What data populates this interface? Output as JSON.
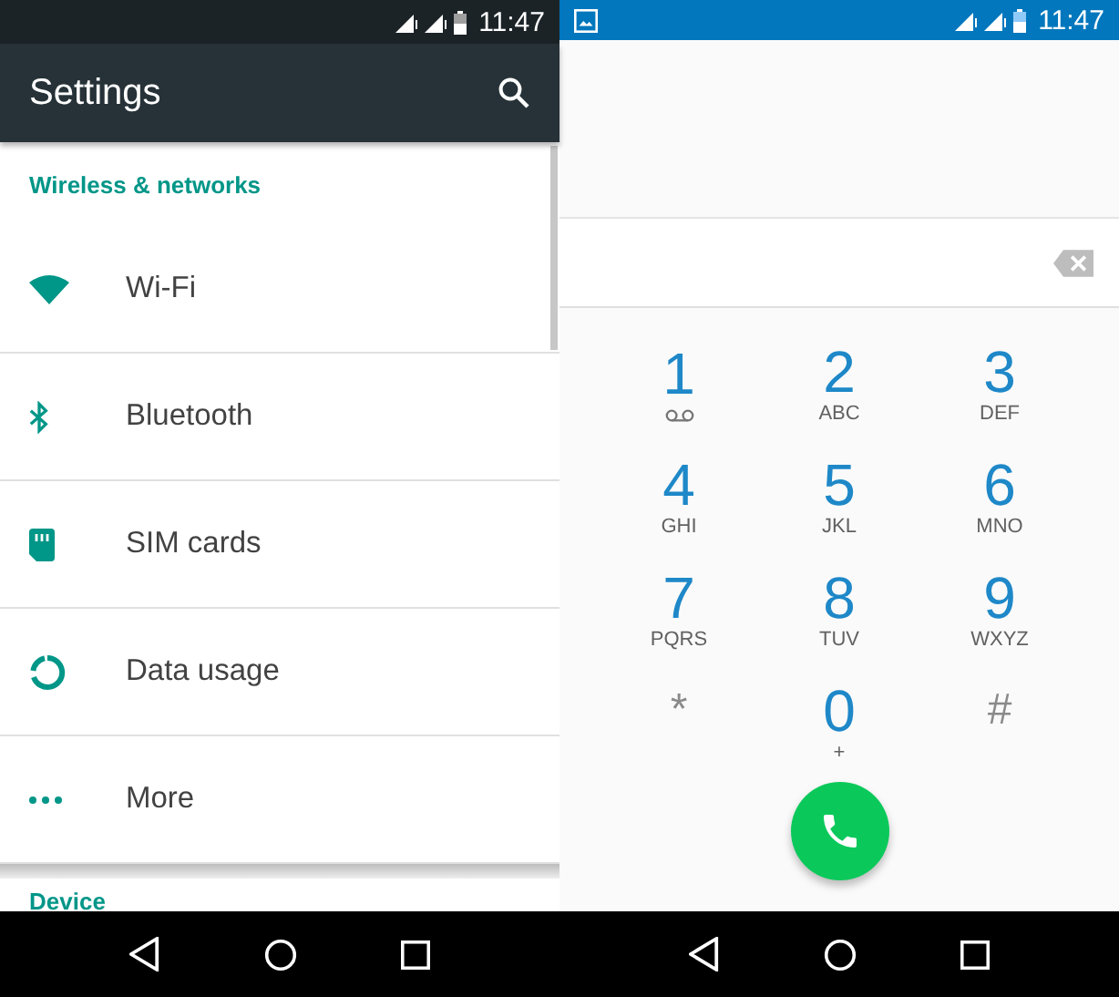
{
  "settings_screen": {
    "status_bar": {
      "time": "11:47"
    },
    "toolbar": {
      "title": "Settings"
    },
    "sections": [
      {
        "header": "Wireless & networks",
        "items": [
          {
            "label": "Wi-Fi"
          },
          {
            "label": "Bluetooth"
          },
          {
            "label": "SIM cards"
          },
          {
            "label": "Data usage"
          },
          {
            "label": "More"
          }
        ]
      },
      {
        "header": "Device"
      }
    ]
  },
  "dialer_screen": {
    "status_bar": {
      "time": "11:47"
    },
    "keys": [
      {
        "kind": "voicemail",
        "digit": "1"
      },
      {
        "kind": "digit",
        "digit": "2",
        "letters": "ABC"
      },
      {
        "kind": "digit",
        "digit": "3",
        "letters": "DEF"
      },
      {
        "kind": "digit",
        "digit": "4",
        "letters": "GHI"
      },
      {
        "kind": "digit",
        "digit": "5",
        "letters": "JKL"
      },
      {
        "kind": "digit",
        "digit": "6",
        "letters": "MNO"
      },
      {
        "kind": "digit",
        "digit": "7",
        "letters": "PQRS"
      },
      {
        "kind": "digit",
        "digit": "8",
        "letters": "TUV"
      },
      {
        "kind": "digit",
        "digit": "9",
        "letters": "WXYZ"
      },
      {
        "kind": "symbol",
        "digit": "*"
      },
      {
        "kind": "digit",
        "digit": "0",
        "letters": "+"
      },
      {
        "kind": "symbol",
        "digit": "#"
      }
    ]
  }
}
